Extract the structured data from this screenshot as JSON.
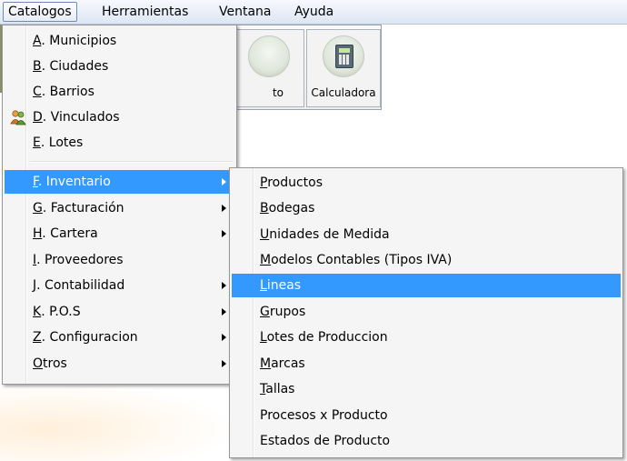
{
  "menubar": [
    {
      "label": "Catalogos",
      "open": true
    },
    {
      "label": "Herramientas"
    },
    {
      "label": "Ventana"
    },
    {
      "label": "Ayuda"
    }
  ],
  "toolbar": {
    "partial_label": "to",
    "calculator_label": "Calculadora",
    "icons": [
      "circle-button-icon",
      "calculator-icon"
    ]
  },
  "catalogos_menu": {
    "items": [
      {
        "mnemonic": "A",
        "text": ". Municipios"
      },
      {
        "mnemonic": "B",
        "text": ". Ciudades"
      },
      {
        "mnemonic": "C",
        "text": ". Barrios"
      },
      {
        "mnemonic": "D",
        "text": ". Vinculados",
        "icon": "people-icon"
      },
      {
        "mnemonic": "E",
        "text": ". Lotes"
      },
      {
        "mnemonic": "F",
        "text": ". Inventario",
        "submenu": true,
        "highlighted": true
      },
      {
        "mnemonic": "G",
        "text": ". Facturación",
        "submenu": true
      },
      {
        "mnemonic": "H",
        "text": ". Cartera",
        "submenu": true
      },
      {
        "mnemonic": "I",
        "text": ". Proveedores"
      },
      {
        "mnemonic": "J",
        "text": ". Contabilidad",
        "submenu": true
      },
      {
        "mnemonic": "K",
        "text": ". P.O.S",
        "submenu": true
      },
      {
        "mnemonic": "Z",
        "text": ". Configuracion",
        "submenu": true
      },
      {
        "mnemonic": "O",
        "text": "tros",
        "submenu": true
      }
    ]
  },
  "inventario_submenu": {
    "items": [
      {
        "mnemonic": "P",
        "text": "roductos"
      },
      {
        "mnemonic": "B",
        "text": "odegas"
      },
      {
        "mnemonic": "U",
        "text": "nidades de Medida"
      },
      {
        "mnemonic": "M",
        "text": "odelos Contables (Tipos IVA)"
      },
      {
        "mnemonic": "L",
        "text": "ineas",
        "highlighted": true
      },
      {
        "mnemonic": "G",
        "text": "rupos"
      },
      {
        "mnemonic": "L",
        "text": "otes de Produccion"
      },
      {
        "mnemonic": "M",
        "text": "arcas"
      },
      {
        "mnemonic": "T",
        "text": "allas"
      },
      {
        "mnemonic": "",
        "text": "Procesos x Producto"
      },
      {
        "mnemonic": "",
        "text": "Estados de Producto"
      }
    ]
  },
  "colors": {
    "highlight": "#3399ff",
    "menu_bg": "#f5f5f5"
  }
}
